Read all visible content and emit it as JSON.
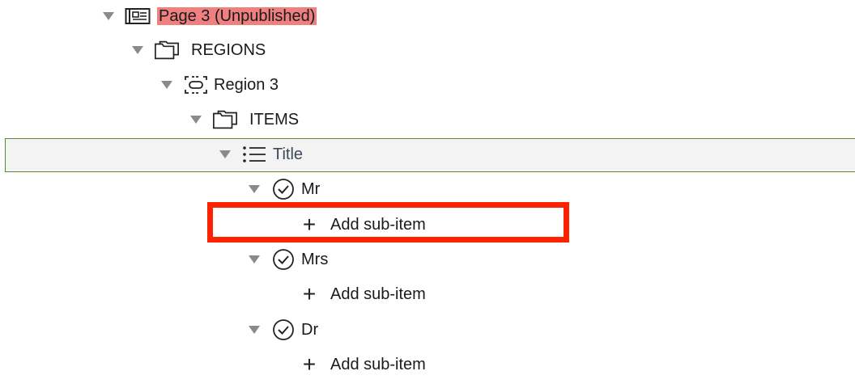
{
  "tree": {
    "page": {
      "label": "Page 3 (Unpublished)",
      "icon": "page-layout-icon"
    },
    "regions": {
      "label": "REGIONS",
      "icon": "folder-icon"
    },
    "region": {
      "label": "Region 3",
      "icon": "region-icon"
    },
    "items": {
      "label": "ITEMS",
      "icon": "folder-icon"
    },
    "title": {
      "label": "Title",
      "icon": "list-icon"
    },
    "options": [
      {
        "label": "Mr",
        "icon": "check-circle-icon",
        "add_label": "Add sub-item"
      },
      {
        "label": "Mrs",
        "icon": "check-circle-icon",
        "add_label": "Add sub-item"
      },
      {
        "label": "Dr",
        "icon": "check-circle-icon",
        "add_label": "Add sub-item"
      }
    ]
  },
  "colors": {
    "unpublished_bg": "#f08080",
    "selected_border": "#5c8a2e",
    "selected_bg": "#f3f3f3",
    "highlight_border": "#ff2200"
  }
}
